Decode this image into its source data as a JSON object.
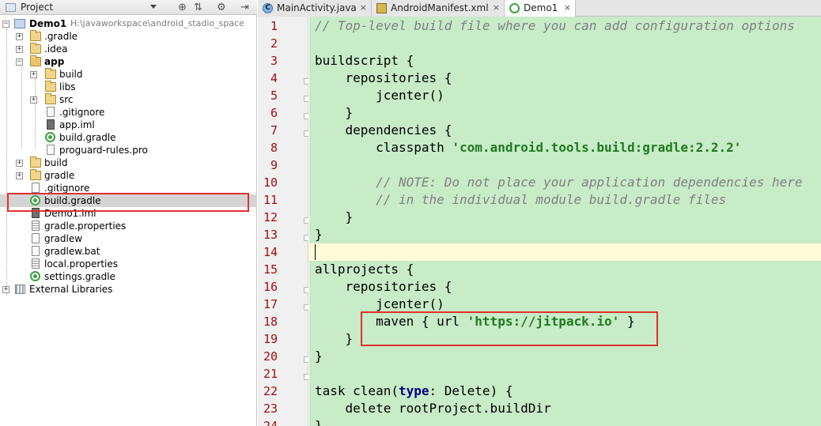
{
  "project_panel": {
    "title": "Project",
    "icons": [
      "locate-icon",
      "collapse-icon",
      "settings-icon",
      "hide-icon"
    ],
    "root": {
      "label": "Demo1",
      "path": "H:\\javaworkspace\\android_stadio_space"
    },
    "items": [
      {
        "label": ".gradle",
        "icon": "folder"
      },
      {
        "label": ".idea",
        "icon": "folder"
      },
      {
        "label": "app",
        "icon": "module-folder"
      },
      {
        "label": "build",
        "icon": "folder"
      },
      {
        "label": "libs",
        "icon": "folder"
      },
      {
        "label": "src",
        "icon": "folder"
      },
      {
        "label": ".gitignore",
        "icon": "file"
      },
      {
        "label": "app.iml",
        "icon": "iml-file"
      },
      {
        "label": "build.gradle",
        "icon": "gradle-file"
      },
      {
        "label": "proguard-rules.pro",
        "icon": "file"
      },
      {
        "label": "build",
        "icon": "folder"
      },
      {
        "label": "gradle",
        "icon": "folder"
      },
      {
        "label": ".gitignore",
        "icon": "file"
      },
      {
        "label": "build.gradle",
        "icon": "gradle-file",
        "selected": true
      },
      {
        "label": "Demo1.iml",
        "icon": "iml-file"
      },
      {
        "label": "gradle.properties",
        "icon": "properties-file"
      },
      {
        "label": "gradlew",
        "icon": "file"
      },
      {
        "label": "gradlew.bat",
        "icon": "file"
      },
      {
        "label": "local.properties",
        "icon": "properties-file"
      },
      {
        "label": "settings.gradle",
        "icon": "gradle-file"
      },
      {
        "label": "External Libraries",
        "icon": "library"
      }
    ]
  },
  "tabs": [
    {
      "label": "MainActivity.java",
      "icon": "class-icon",
      "close": "×",
      "active": false
    },
    {
      "label": "AndroidManifest.xml",
      "icon": "manifest-icon",
      "close": "×",
      "active": false
    },
    {
      "label": "Demo1",
      "icon": "gradle-icon",
      "close": "×",
      "active": true
    }
  ],
  "editor": {
    "current_line": 14,
    "lines": [
      {
        "n": "1",
        "code": "// Top-level build file where you can add configuration options"
      },
      {
        "n": "2",
        "code": ""
      },
      {
        "n": "3",
        "code": "buildscript {"
      },
      {
        "n": "4",
        "code": "    repositories {"
      },
      {
        "n": "5",
        "code": "        jcenter()"
      },
      {
        "n": "6",
        "code": "    }"
      },
      {
        "n": "7",
        "code": "    dependencies {"
      },
      {
        "n": "8",
        "code": "        classpath 'com.android.tools.build:gradle:2.2.2'"
      },
      {
        "n": "9",
        "code": ""
      },
      {
        "n": "10",
        "code": "        // NOTE: Do not place your application dependencies here"
      },
      {
        "n": "11",
        "code": "        // in the individual module build.gradle files"
      },
      {
        "n": "12",
        "code": "    }"
      },
      {
        "n": "13",
        "code": "}"
      },
      {
        "n": "14",
        "code": ""
      },
      {
        "n": "15",
        "code": "allprojects {"
      },
      {
        "n": "16",
        "code": "    repositories {"
      },
      {
        "n": "17",
        "code": "        jcenter()"
      },
      {
        "n": "18",
        "code": "        maven { url 'https://jitpack.io' }"
      },
      {
        "n": "19",
        "code": "    }"
      },
      {
        "n": "20",
        "code": "}"
      },
      {
        "n": "21",
        "code": ""
      },
      {
        "n": "22",
        "code": "task clean(type: Delete) {"
      },
      {
        "n": "23",
        "code": "    delete rootProject.buildDir"
      },
      {
        "n": "24",
        "code": "}"
      }
    ]
  },
  "colors": {
    "code_bg": "#c8ebc8",
    "line_numbers": "#a01010",
    "string": "#1f7a1f",
    "comment": "#808080",
    "highlight_box": "#e03030"
  }
}
